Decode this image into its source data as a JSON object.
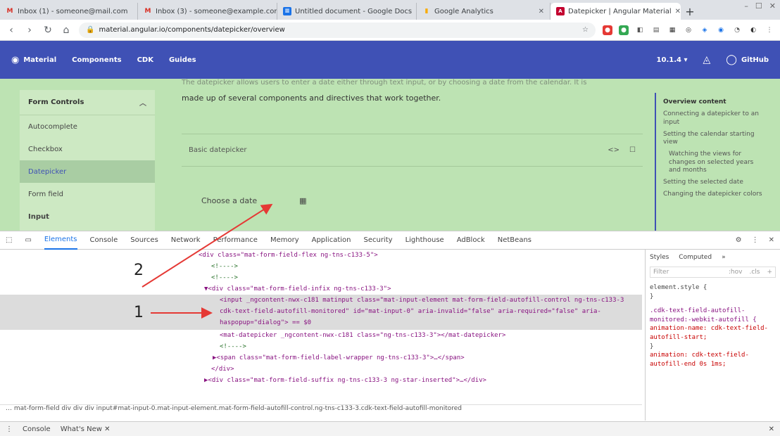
{
  "browser": {
    "tabs": [
      {
        "label": "Inbox (1) - someone@mail.com",
        "icon": "gmail-icon",
        "glyph": "M"
      },
      {
        "label": "Inbox (3) - someone@example.com",
        "icon": "gmail-icon",
        "glyph": "M"
      },
      {
        "label": "Untitled document - Google Docs",
        "icon": "docs-icon",
        "glyph": "≡"
      },
      {
        "label": "Google Analytics",
        "icon": "analytics-icon",
        "glyph": "▮"
      },
      {
        "label": "Datepicker | Angular Material",
        "icon": "angular-icon",
        "glyph": "A",
        "active": true
      }
    ],
    "new_tab": "+",
    "window_controls": [
      "–",
      "☐",
      "✕"
    ],
    "url": "material.angular.io/components/datepicker/overview"
  },
  "site_header": {
    "logo": "Material",
    "nav": [
      "Components",
      "CDK",
      "Guides"
    ],
    "version": "10.1.4 ▾",
    "github": "GitHub"
  },
  "sidenav": {
    "section": "Form Controls",
    "items": [
      "Autocomplete",
      "Checkbox",
      "Datepicker",
      "Form field",
      "Input"
    ],
    "selected": "Datepicker"
  },
  "main": {
    "top_line": "The datepicker allows users to enter a date either through text input, or by choosing a date from the calendar. It is",
    "desc": "made up of several components and directives that work together.",
    "example_title": "Basic datepicker",
    "example_actions": [
      "<>",
      "☐"
    ],
    "field_label": "Choose a date",
    "field_icon": "▦"
  },
  "toc": {
    "title": "Overview content",
    "items": [
      {
        "text": "Connecting a datepicker to an input",
        "sub": false
      },
      {
        "text": "Setting the calendar starting view",
        "sub": false
      },
      {
        "text": "Watching the views for changes on selected years and months",
        "sub": true
      },
      {
        "text": "Setting the selected date",
        "sub": false
      },
      {
        "text": "Changing the datepicker colors",
        "sub": false
      }
    ]
  },
  "devtools": {
    "tabs": [
      "Elements",
      "Console",
      "Sources",
      "Network",
      "Performance",
      "Memory",
      "Application",
      "Security",
      "Lighthouse",
      "AdBlock",
      "NetBeans"
    ],
    "active_tab": "Elements",
    "lines": [
      "<div class=\"mat-form-field-flex ng-tns-c133-5\">",
      "<!---->",
      "<!---->",
      "▼<div class=\"mat-form-field-infix ng-tns-c133-3\">",
      "<input _ngcontent-nwx-c181 matinput class=\"mat-input-element mat-form-field-autofill-control ng-tns-c133-3 cdk-text-field-autofill-monitored\" id=\"mat-input-0\" aria-invalid=\"false\" aria-required=\"false\" aria-haspopup=\"dialog\"> == $0",
      "<mat-datepicker _ngcontent-nwx-c181 class=\"ng-tns-c133-3\"></mat-datepicker>",
      "<!---->",
      "▶<span class=\"mat-form-field-label-wrapper ng-tns-c133-3\">…</span>",
      "</div>",
      "▶<div class=\"mat-form-field-suffix ng-tns-c133-3 ng-star-inserted\">…</div>",
      "<!---->"
    ],
    "breadcrumb": "…   mat-form-field   div   div   div   input#mat-input-0.mat-input-element.mat-form-field-autofill-control.ng-tns-c133-3.cdk-text-field-autofill-monitored",
    "styles_tabs": [
      "Styles",
      "Computed",
      "»"
    ],
    "filter_placeholder": "Filter",
    "filter_options": [
      ":hov",
      ".cls",
      "+"
    ],
    "style_rules": [
      "element.style {",
      "}",
      ".cdk-text-field-autofill-monitored:-webkit-autofill {",
      "  animation-name: cdk-text-field-autofill-start;",
      "}",
      "  animation: cdk-text-field-autofill-end 0s 1ms;"
    ],
    "drawer_tabs": [
      "Console",
      "What's New ✕"
    ]
  },
  "annotations": {
    "label_1": "1",
    "label_2": "2"
  },
  "colors": {
    "header": "#3f51b5",
    "content_bg": "#bde3b3",
    "arrow": "#e53935"
  }
}
